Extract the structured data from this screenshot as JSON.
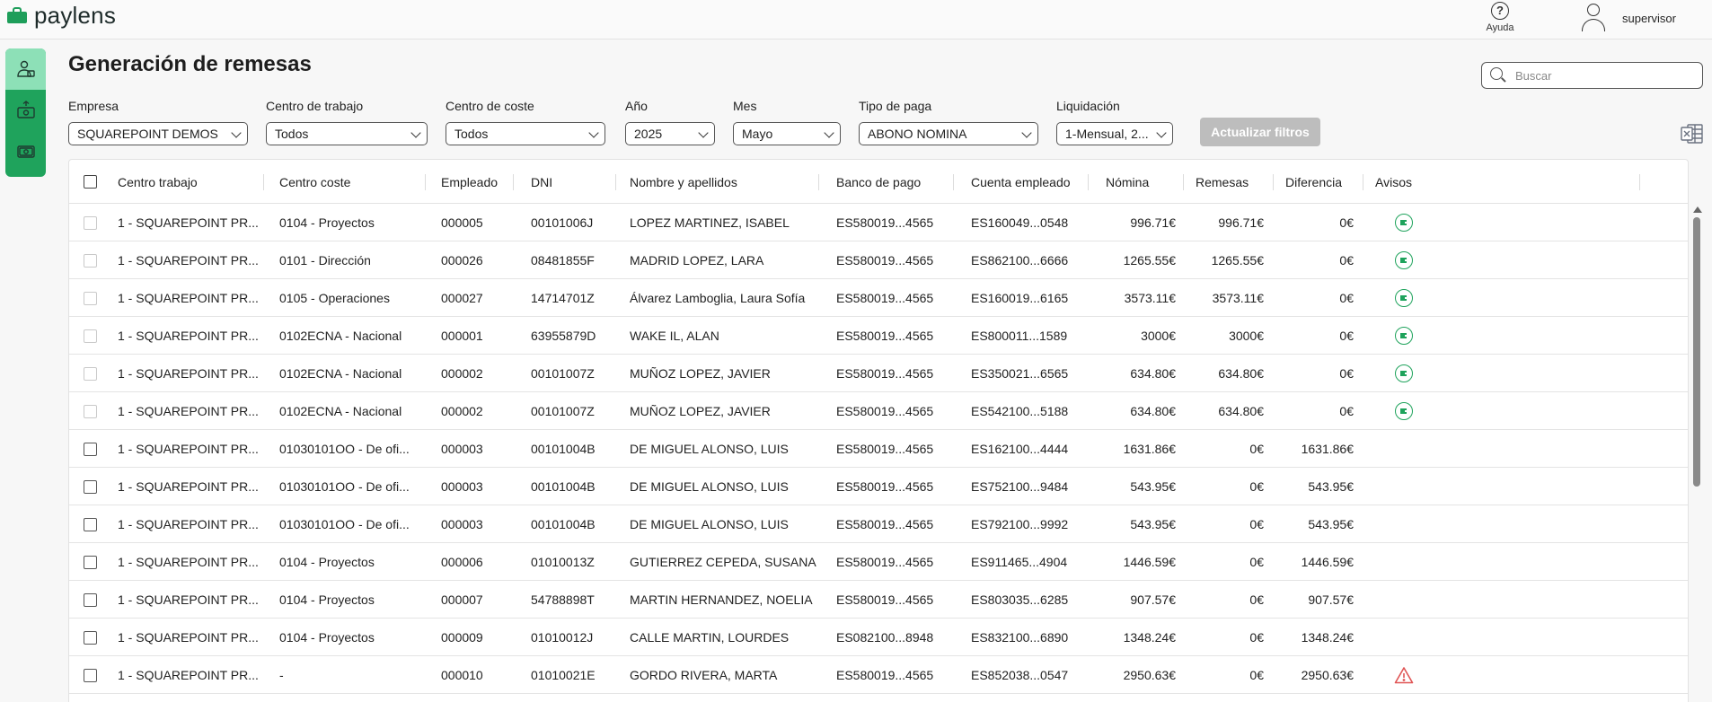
{
  "app": {
    "logo_text": "paylens",
    "help_label": "Ayuda",
    "help_glyph": "?",
    "user_name": "supervisor"
  },
  "page": {
    "title": "Generación de remesas"
  },
  "search": {
    "placeholder": "Buscar"
  },
  "filters": {
    "empresa": {
      "label": "Empresa",
      "value": "SQUAREPOINT DEMOS"
    },
    "centro_trabajo": {
      "label": "Centro de trabajo",
      "value": "Todos"
    },
    "centro_coste": {
      "label": "Centro de coste",
      "value": "Todos"
    },
    "anio": {
      "label": "Año",
      "value": "2025"
    },
    "mes": {
      "label": "Mes",
      "value": "Mayo"
    },
    "tipo_paga": {
      "label": "Tipo de paga",
      "value": "ABONO NOMINA"
    },
    "liquidacion": {
      "label": "Liquidación",
      "value": "1-Mensual, 2..."
    },
    "update_button": "Actualizar filtros"
  },
  "table": {
    "columns": [
      "Centro trabajo",
      "Centro coste",
      "Empleado",
      "DNI",
      "Nombre y apellidos",
      "Banco de pago",
      "Cuenta empleado",
      "Nómina",
      "Remesas",
      "Diferencia",
      "Avisos"
    ],
    "rows": [
      {
        "centro_trabajo": "1 - SQUAREPOINT PR...",
        "centro_coste": "0104 - Proyectos",
        "empleado": "000005",
        "dni": "00101006J",
        "nombre": "LOPEZ MARTINEZ, ISABEL",
        "banco": "ES580019...4565",
        "cuenta": "ES160049...0548",
        "nomina": "996.71€",
        "remesas": "996.71€",
        "diferencia": "0€",
        "aviso": "ok",
        "selectable": false
      },
      {
        "centro_trabajo": "1 - SQUAREPOINT PR...",
        "centro_coste": "0101 - Dirección",
        "empleado": "000026",
        "dni": "08481855F",
        "nombre": "MADRID LOPEZ, LARA",
        "banco": "ES580019...4565",
        "cuenta": "ES862100...6666",
        "nomina": "1265.55€",
        "remesas": "1265.55€",
        "diferencia": "0€",
        "aviso": "ok",
        "selectable": false
      },
      {
        "centro_trabajo": "1 - SQUAREPOINT PR...",
        "centro_coste": "0105 - Operaciones",
        "empleado": "000027",
        "dni": "14714701Z",
        "nombre": "Álvarez Lamboglia, Laura Sofía",
        "banco": "ES580019...4565",
        "cuenta": "ES160019...6165",
        "nomina": "3573.11€",
        "remesas": "3573.11€",
        "diferencia": "0€",
        "aviso": "ok",
        "selectable": false
      },
      {
        "centro_trabajo": "1 - SQUAREPOINT PR...",
        "centro_coste": "0102ECNA - Nacional",
        "empleado": "000001",
        "dni": "63955879D",
        "nombre": "WAKE IL, ALAN",
        "banco": "ES580019...4565",
        "cuenta": "ES800011...1589",
        "nomina": "3000€",
        "remesas": "3000€",
        "diferencia": "0€",
        "aviso": "ok",
        "selectable": false
      },
      {
        "centro_trabajo": "1 - SQUAREPOINT PR...",
        "centro_coste": "0102ECNA - Nacional",
        "empleado": "000002",
        "dni": "00101007Z",
        "nombre": "MUÑOZ LOPEZ, JAVIER",
        "banco": "ES580019...4565",
        "cuenta": "ES350021...6565",
        "nomina": "634.80€",
        "remesas": "634.80€",
        "diferencia": "0€",
        "aviso": "ok",
        "selectable": false
      },
      {
        "centro_trabajo": "1 - SQUAREPOINT PR...",
        "centro_coste": "0102ECNA - Nacional",
        "empleado": "000002",
        "dni": "00101007Z",
        "nombre": "MUÑOZ LOPEZ, JAVIER",
        "banco": "ES580019...4565",
        "cuenta": "ES542100...5188",
        "nomina": "634.80€",
        "remesas": "634.80€",
        "diferencia": "0€",
        "aviso": "ok",
        "selectable": false
      },
      {
        "centro_trabajo": "1 - SQUAREPOINT PR...",
        "centro_coste": "01030101OO - De ofi...",
        "empleado": "000003",
        "dni": "00101004B",
        "nombre": "DE MIGUEL ALONSO, LUIS",
        "banco": "ES580019...4565",
        "cuenta": "ES162100...4444",
        "nomina": "1631.86€",
        "remesas": "0€",
        "diferencia": "1631.86€",
        "aviso": "",
        "selectable": true
      },
      {
        "centro_trabajo": "1 - SQUAREPOINT PR...",
        "centro_coste": "01030101OO - De ofi...",
        "empleado": "000003",
        "dni": "00101004B",
        "nombre": "DE MIGUEL ALONSO, LUIS",
        "banco": "ES580019...4565",
        "cuenta": "ES752100...9484",
        "nomina": "543.95€",
        "remesas": "0€",
        "diferencia": "543.95€",
        "aviso": "",
        "selectable": true
      },
      {
        "centro_trabajo": "1 - SQUAREPOINT PR...",
        "centro_coste": "01030101OO - De ofi...",
        "empleado": "000003",
        "dni": "00101004B",
        "nombre": "DE MIGUEL ALONSO, LUIS",
        "banco": "ES580019...4565",
        "cuenta": "ES792100...9992",
        "nomina": "543.95€",
        "remesas": "0€",
        "diferencia": "543.95€",
        "aviso": "",
        "selectable": true
      },
      {
        "centro_trabajo": "1 - SQUAREPOINT PR...",
        "centro_coste": "0104 - Proyectos",
        "empleado": "000006",
        "dni": "01010013Z",
        "nombre": "GUTIERREZ CEPEDA, SUSANA",
        "banco": "ES580019...4565",
        "cuenta": "ES911465...4904",
        "nomina": "1446.59€",
        "remesas": "0€",
        "diferencia": "1446.59€",
        "aviso": "",
        "selectable": true
      },
      {
        "centro_trabajo": "1 - SQUAREPOINT PR...",
        "centro_coste": "0104 - Proyectos",
        "empleado": "000007",
        "dni": "54788898T",
        "nombre": "MARTIN HERNANDEZ, NOELIA",
        "banco": "ES580019...4565",
        "cuenta": "ES803035...6285",
        "nomina": "907.57€",
        "remesas": "0€",
        "diferencia": "907.57€",
        "aviso": "",
        "selectable": true
      },
      {
        "centro_trabajo": "1 - SQUAREPOINT PR...",
        "centro_coste": "0104 - Proyectos",
        "empleado": "000009",
        "dni": "01010012J",
        "nombre": "CALLE MARTIN, LOURDES",
        "banco": "ES082100...8948",
        "cuenta": "ES832100...6890",
        "nomina": "1348.24€",
        "remesas": "0€",
        "diferencia": "1348.24€",
        "aviso": "",
        "selectable": true
      },
      {
        "centro_trabajo": "1 - SQUAREPOINT PR...",
        "centro_coste": "-",
        "empleado": "000010",
        "dni": "01010021E",
        "nombre": "GORDO RIVERA, MARTA",
        "banco": "ES580019...4565",
        "cuenta": "ES852038...0547",
        "nomina": "2950.63€",
        "remesas": "0€",
        "diferencia": "2950.63€",
        "aviso": "warning",
        "selectable": true
      }
    ]
  },
  "icons": {
    "logo": "briefcase-icon",
    "help": "help-circle-icon",
    "user": "user-icon",
    "search": "search-icon",
    "excel": "excel-export-icon",
    "ok": "status-ok-icon",
    "warning": "warning-triangle-icon",
    "sidebar": [
      "employees-icon",
      "remittance-upload-icon",
      "payments-icon"
    ]
  },
  "colors": {
    "brand_green": "#1fa35c",
    "sidebar_active": "#8de0b7",
    "warning_red": "#e05555",
    "button_disabled": "#bdbdbd"
  }
}
